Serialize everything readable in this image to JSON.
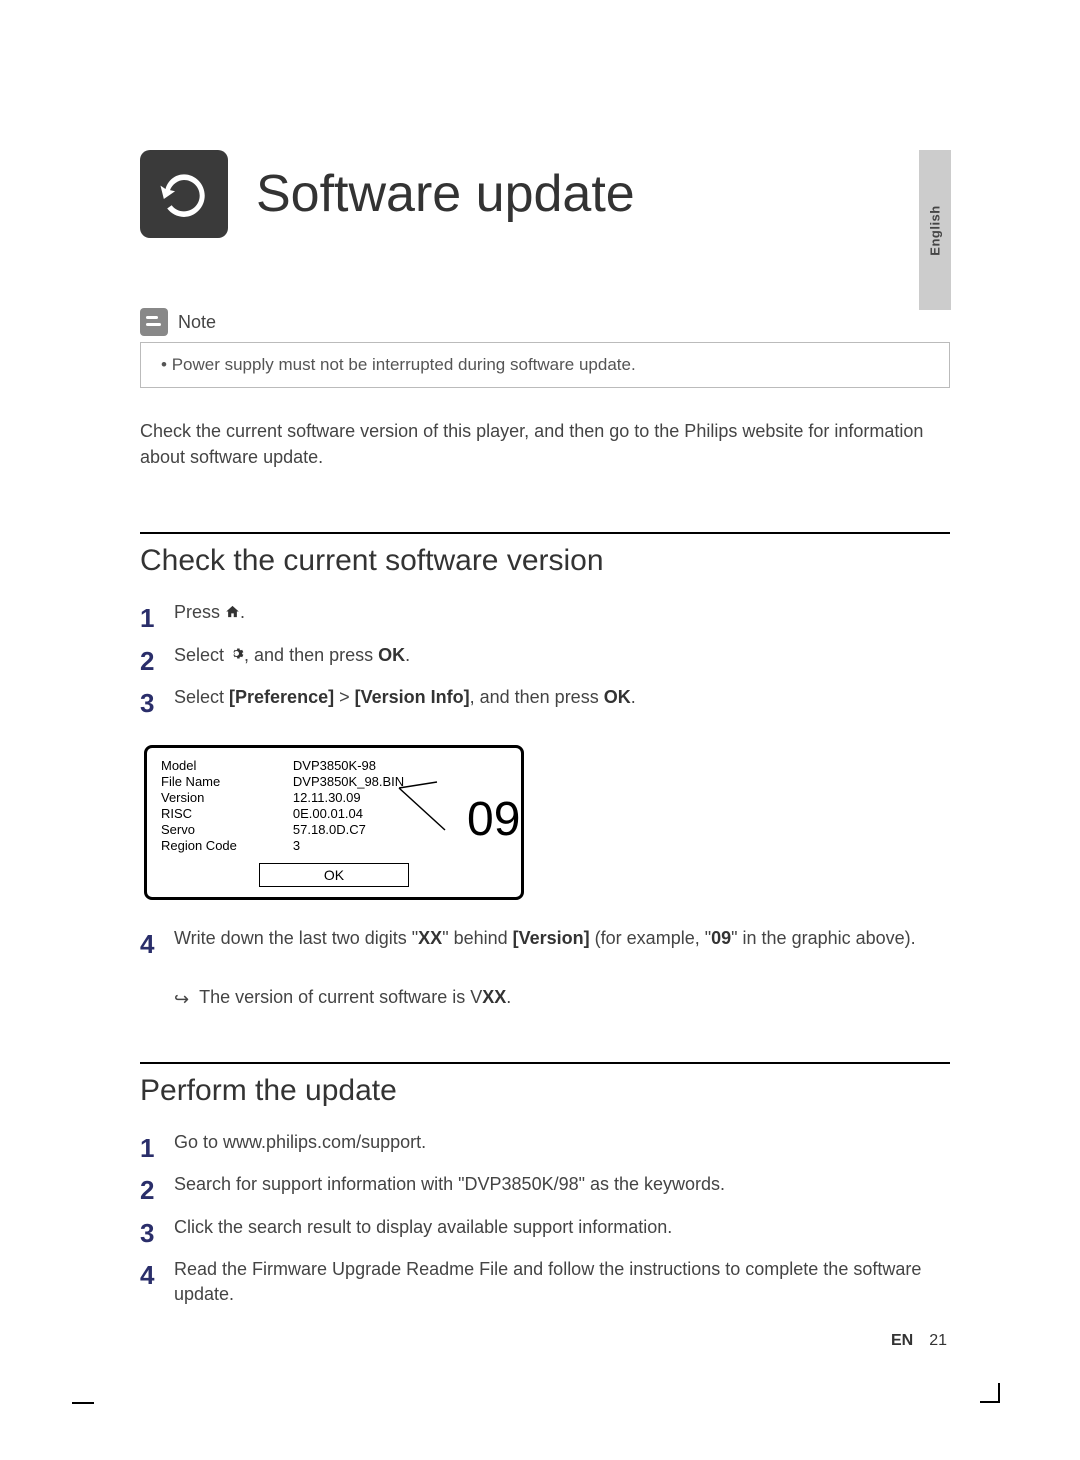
{
  "langTab": "English",
  "title": "Software update",
  "note": {
    "label": "Note",
    "items": [
      "Power supply must not be interrupted during software update."
    ]
  },
  "intro": "Check the current software version of this player, and then go to the Philips website for information about software update.",
  "sectionA": {
    "heading": "Check the current software version",
    "step1_a": "Press ",
    "step1_b": ".",
    "step2_a": "Select ",
    "step2_b": ", and then press ",
    "step2_ok": "OK",
    "step2_c": ".",
    "step3_a": "Select ",
    "step3_pref": "[Preference]",
    "step3_gt": " > ",
    "step3_vi": "[Version Info]",
    "step3_b": ", and then press ",
    "step3_ok": "OK",
    "step3_c": ".",
    "graphic": {
      "labels": [
        "Model",
        "File Name",
        "Version",
        "RISC",
        "Servo",
        "Region Code"
      ],
      "values": [
        "DVP3850K-98",
        "DVP3850K_98.BIN",
        "12.11.30.09",
        "0E.00.01.04",
        "57.18.0D.C7",
        "3"
      ],
      "ok": "OK",
      "callout": "09"
    },
    "step4_a": "Write down the last two digits \"",
    "step4_xx": "XX",
    "step4_b": "\" behind ",
    "step4_ver": "[Version]",
    "step4_c": " (for example, \"",
    "step4_09": "09",
    "step4_d": "\" in the graphic above).",
    "step4_sub_a": "The version of current software is V",
    "step4_sub_xx": "XX",
    "step4_sub_b": "."
  },
  "sectionB": {
    "heading": "Perform the update",
    "step1": "Go to www.philips.com/support.",
    "step2": "Search for support information with \"DVP3850K/98\" as the keywords.",
    "step3": "Click the search result to display available support information.",
    "step4": "Read the Firmware Upgrade Readme File and follow the instructions to complete the software update."
  },
  "footer": {
    "lang": "EN",
    "page": "21"
  }
}
